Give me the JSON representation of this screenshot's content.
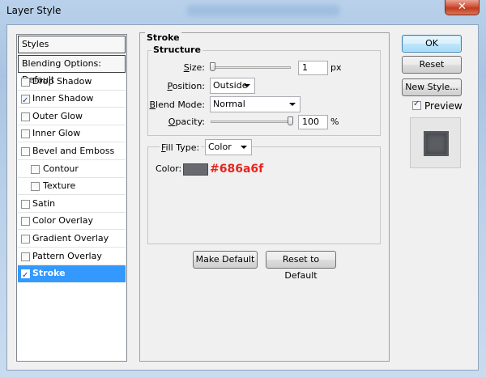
{
  "window": {
    "title": "Layer Style",
    "close_glyph": "✕"
  },
  "styles_list": {
    "header": "Styles",
    "blending": "Blending Options: Default",
    "items": [
      {
        "label": "Drop Shadow",
        "checked": false
      },
      {
        "label": "Inner Shadow",
        "checked": true
      },
      {
        "label": "Outer Glow",
        "checked": false
      },
      {
        "label": "Inner Glow",
        "checked": false
      },
      {
        "label": "Bevel and Emboss",
        "checked": false
      },
      {
        "label": "Contour",
        "checked": false
      },
      {
        "label": "Texture",
        "checked": false
      },
      {
        "label": "Satin",
        "checked": false
      },
      {
        "label": "Color Overlay",
        "checked": false
      },
      {
        "label": "Gradient Overlay",
        "checked": false
      },
      {
        "label": "Pattern Overlay",
        "checked": false
      },
      {
        "label": "Stroke",
        "checked": true,
        "selected": true
      }
    ]
  },
  "stroke": {
    "title": "Stroke",
    "structure": {
      "title": "Structure",
      "size_label": "Size:",
      "size_value": "1",
      "size_unit": "px",
      "size_slider_fraction": 0.0,
      "position_label": "Position:",
      "position_value": "Outside",
      "blend_label": "Blend Mode:",
      "blend_value": "Normal",
      "opacity_label": "Opacity:",
      "opacity_value": "100",
      "opacity_unit": "%",
      "opacity_slider_fraction": 1.0
    },
    "fill": {
      "type_label": "Fill Type:",
      "type_value": "Color",
      "color_label": "Color:",
      "color_hex": "#686a6f",
      "color_annotation": "#686a6f"
    },
    "make_default": "Make Default",
    "reset_default": "Reset to Default"
  },
  "actions": {
    "ok": "OK",
    "reset": "Reset",
    "new_style": "New Style...",
    "preview_label": "Preview",
    "preview_checked": true
  },
  "colors": {
    "selection": "#3399ff",
    "annotation": "#e8241c",
    "swatch": "#686a6f"
  }
}
